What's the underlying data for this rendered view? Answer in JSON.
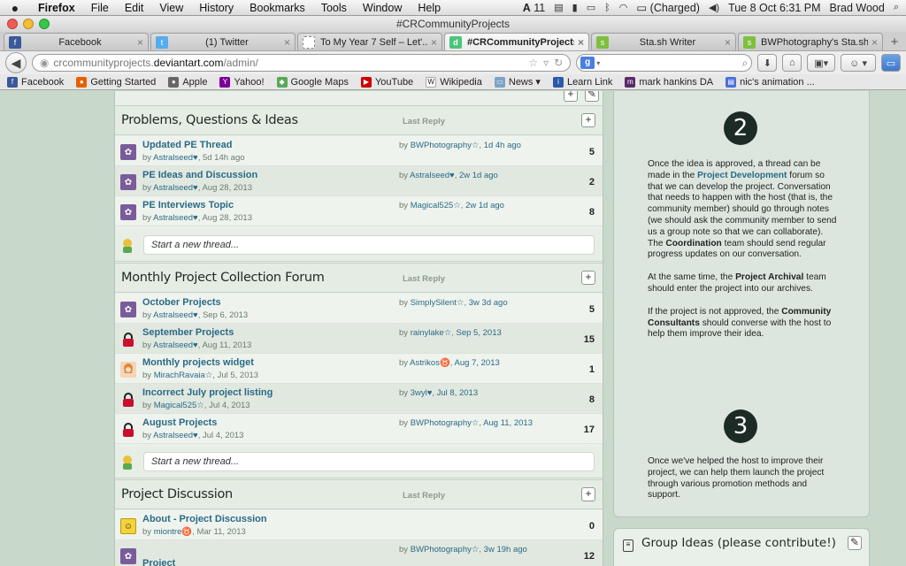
{
  "menubar": {
    "app": "Firefox",
    "items": [
      "File",
      "Edit",
      "View",
      "History",
      "Bookmarks",
      "Tools",
      "Window",
      "Help"
    ],
    "status": {
      "adobe": "11",
      "battery": "(Charged)",
      "clock": "Tue 8 Oct  6:31 PM",
      "user": "Brad Wood"
    }
  },
  "window": {
    "title": "#CRCommunityProjects"
  },
  "tabs": [
    {
      "label": "Facebook",
      "icon": "facebook-icon",
      "color": "#3b5998"
    },
    {
      "label": "(1) Twitter",
      "icon": "twitter-icon",
      "color": "#55acee"
    },
    {
      "label": "To My Year 7 Self – Let'...",
      "icon": "page-icon",
      "color": "#aaaaaa"
    },
    {
      "label": "#CRCommunityProjects",
      "icon": "deviantart-icon",
      "color": "#4dc47d"
    },
    {
      "label": "Sta.sh Writer",
      "icon": "stash-icon",
      "color": "#7fbf3f"
    },
    {
      "label": "BWPhotography's Sta.sh",
      "icon": "stash-icon",
      "color": "#7fbf3f"
    }
  ],
  "url": {
    "prefix": "crcommunityprojects.",
    "host": "deviantart.com",
    "path": "/admin/"
  },
  "bookmarks": [
    {
      "label": "Facebook",
      "color": "#3b5998",
      "glyph": "f"
    },
    {
      "label": "Getting Started",
      "color": "#e66000",
      "glyph": "●"
    },
    {
      "label": "Apple",
      "color": "#666666",
      "glyph": "●"
    },
    {
      "label": "Yahoo!",
      "color": "#7b0099",
      "glyph": "Y"
    },
    {
      "label": "Google Maps",
      "color": "#5aa85a",
      "glyph": "◆"
    },
    {
      "label": "YouTube",
      "color": "#cc0000",
      "glyph": "▶"
    },
    {
      "label": "Wikipedia",
      "color": "#555555",
      "glyph": "W"
    },
    {
      "label": "News ▾",
      "color": "#7ea3c9",
      "glyph": "▭"
    },
    {
      "label": "Learn Link",
      "color": "#2a5aa8",
      "glyph": "i"
    },
    {
      "label": "mark hankins DA",
      "color": "#5a2a6a",
      "glyph": "m"
    },
    {
      "label": "nic's animation ...",
      "color": "#4a6fd8",
      "glyph": "▤"
    }
  ],
  "forums": [
    {
      "title": "Problems, Questions & Ideas",
      "last_reply_label": "Last Reply",
      "threads": [
        {
          "title": "Updated PE Thread",
          "author": "Astralseed♥",
          "date": "5d 14h ago",
          "reply_user": "BWPhotography☆",
          "reply_time": "1d 4h ago",
          "count": "5",
          "avatar": "purple"
        },
        {
          "title": "PE Ideas and Discussion",
          "author": "Astralseed♥",
          "date": "Aug 28, 2013",
          "reply_user": "Astralseed♥",
          "reply_time": "2w 1d ago",
          "count": "2",
          "avatar": "purple"
        },
        {
          "title": "PE Interviews Topic",
          "author": "Astralseed♥",
          "date": "Aug 28, 2013",
          "reply_user": "Magical525☆",
          "reply_time": "2w 1d ago",
          "count": "8",
          "avatar": "purple"
        }
      ],
      "new_thread": "Start a new thread..."
    },
    {
      "title": "Monthly Project Collection Forum",
      "last_reply_label": "Last Reply",
      "threads": [
        {
          "title": "October Projects",
          "author": "Astralseed♥",
          "date": "Sep 6, 2013",
          "reply_user": "SimplySilent☆",
          "reply_time": "3w 3d ago",
          "count": "5",
          "avatar": "purple"
        },
        {
          "title": "September Projects",
          "author": "Astralseed♥",
          "date": "Aug 11, 2013",
          "reply_user": "rainylake☆",
          "reply_time": "Sep 5, 2013",
          "count": "15",
          "avatar": "lock"
        },
        {
          "title": "Monthly projects widget",
          "author": "MirachRavaia☆",
          "date": "Jul 5, 2013",
          "reply_user": "Astrikos♉",
          "reply_time": "Aug 7, 2013",
          "count": "1",
          "avatar": "girl"
        },
        {
          "title": "Incorrect July project listing",
          "author": "Magical525☆",
          "date": "Jul 4, 2013",
          "reply_user": "3wyl♥",
          "reply_time": "Jul 8, 2013",
          "count": "8",
          "avatar": "lock"
        },
        {
          "title": "August Projects",
          "author": "Astralseed♥",
          "date": "Jul 4, 2013",
          "reply_user": "BWPhotography☆",
          "reply_time": "Aug 11, 2013",
          "count": "17",
          "avatar": "lock"
        }
      ],
      "new_thread": "Start a new thread..."
    },
    {
      "title": "Project Discussion",
      "last_reply_label": "Last Reply",
      "threads": [
        {
          "title": "About - Project Discussion",
          "author": "miontre♉",
          "date": "Mar 11, 2013",
          "reply_user": "",
          "reply_time": "",
          "count": "0",
          "avatar": "yellow"
        },
        {
          "title": "Project",
          "author": "",
          "date": "",
          "reply_user": "BWPhotography☆",
          "reply_time": "3w 19h ago",
          "count": "12",
          "avatar": "purple"
        }
      ]
    }
  ],
  "steps": [
    {
      "number": "2",
      "paragraphs": [
        [
          "Once the idea is approved, a thread can be made in the ",
          {
            "link": "Project Development"
          },
          " forum so that we can develop the project. Conversation that needs to happen with the host (that is, the community member) should go through notes (we should ask the community member to send us a group note so that we can collaborate). The ",
          {
            "bold": "Coordination"
          },
          " team should send regular progress updates on our conversation."
        ],
        [
          "At the same time, the ",
          {
            "bold": "Project Archival"
          },
          " team should enter the project into our archives."
        ],
        [
          "If the project is not approved, the ",
          {
            "bold": "Community Consultants"
          },
          " should converse with the host to help them improve their idea."
        ]
      ]
    },
    {
      "number": "3",
      "paragraphs": [
        [
          "Once we've helped the host to improve their project, we can help them launch the project through various promotion methods and support."
        ]
      ]
    }
  ],
  "group_ideas": {
    "title": "Group Ideas (please contribute!)"
  }
}
